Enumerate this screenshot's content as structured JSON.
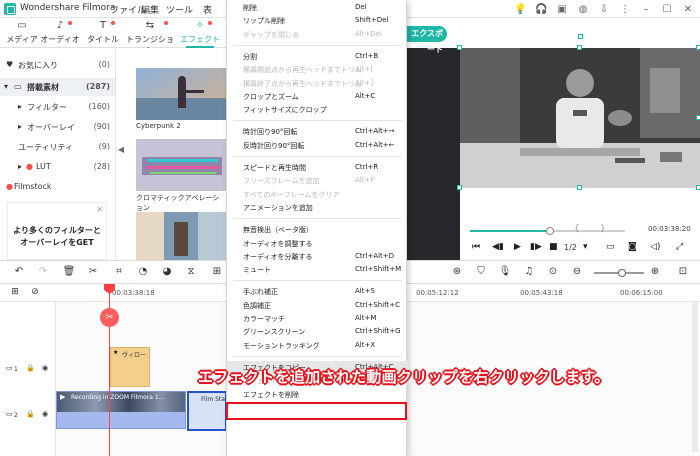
{
  "app": {
    "title": "Wondershare Filmora"
  },
  "menubar": {
    "items": [
      "ファイル",
      "編集",
      "ツール",
      "表"
    ]
  },
  "media_tabs": [
    {
      "label": "メディア",
      "icon": "folder-icon",
      "badge": false
    },
    {
      "label": "オーディオ",
      "icon": "music-note-icon",
      "badge": true
    },
    {
      "label": "タイトル",
      "icon": "text-icon",
      "badge": true
    },
    {
      "label": "トランジション",
      "icon": "transition-icon",
      "badge": true
    },
    {
      "label": "エフェクト",
      "icon": "effect-icon",
      "badge": true,
      "active": true
    }
  ],
  "categories": [
    {
      "label": "お気に入り",
      "count": "(0)",
      "icon": "heart-icon"
    },
    {
      "label": "搭載素材",
      "count": "(287)",
      "icon": "folder-icon",
      "selected": true
    },
    {
      "label": "フィルター",
      "count": "(160)"
    },
    {
      "label": "オーバーレイ",
      "count": "(90)"
    },
    {
      "label": "ユーティリティ",
      "count": "(9)"
    },
    {
      "label": "LUT",
      "count": "(28)"
    },
    {
      "label": "Filmstock",
      "count": ""
    }
  ],
  "promo": {
    "line1": "より多くのフィルターと",
    "line2": "オーバーレイをGET"
  },
  "thumbnails": [
    {
      "label": "Cyberpunk 2"
    },
    {
      "label": "クロマティックアベレーション"
    },
    {
      "label": ""
    }
  ],
  "export": {
    "label": "エクスポート"
  },
  "player": {
    "timecode": "00:03:38:20",
    "speed": "1/2"
  },
  "timeline": {
    "ruler": [
      "00:03:38:18",
      "00:05:12:12",
      "00:05:43:18",
      "00:06:15:00"
    ],
    "tracks": [
      {
        "index": "1",
        "clip_label": "ヴィロー"
      },
      {
        "index": "2",
        "clip_label": "Recording in ZOOM Filmora 1..."
      }
    ],
    "clip2_label": "Film Start"
  },
  "context_menu": {
    "items": [
      {
        "label": "削除",
        "shortcut": "Del"
      },
      {
        "label": "リップル削除",
        "shortcut": "Shift+Del"
      },
      {
        "label": "ギャップを閉じる",
        "shortcut": "Alt+Del",
        "disabled": true
      },
      {
        "sep": true
      },
      {
        "label": "分割",
        "shortcut": "Ctrl+B"
      },
      {
        "label": "横幕開始点から再生ヘッドまでトリム",
        "shortcut": "Alt+[",
        "disabled": true
      },
      {
        "label": "横幕終了点から再生ヘッドまでトリム",
        "shortcut": "Alt+]",
        "disabled": true
      },
      {
        "label": "クロップとズーム",
        "shortcut": "Alt+C"
      },
      {
        "label": "フィットサイズにクロップ",
        "shortcut": ""
      },
      {
        "sep": true
      },
      {
        "label": "時計回り90°回転",
        "shortcut": "Ctrl+Alt+→"
      },
      {
        "label": "反時計回り90°回転",
        "shortcut": "Ctrl+Alt+←"
      },
      {
        "sep": true
      },
      {
        "label": "スピードと再生時間",
        "shortcut": "Ctrl+R"
      },
      {
        "label": "フリーズフレームを追加",
        "shortcut": "Alt+F",
        "disabled": true
      },
      {
        "label": "すべてのキーフレームをクリア",
        "shortcut": "",
        "disabled": true
      },
      {
        "label": "アニメーションを追加",
        "shortcut": ""
      },
      {
        "sep": true
      },
      {
        "label": "無音検出（ベータ版）",
        "shortcut": ""
      },
      {
        "label": "オーディオを調整する",
        "shortcut": ""
      },
      {
        "label": "オーディオを分離する",
        "shortcut": "Ctrl+Alt+D"
      },
      {
        "label": "ミュート",
        "shortcut": "Ctrl+Shift+M"
      },
      {
        "sep": true
      },
      {
        "label": "手ぶれ補正",
        "shortcut": "Alt+S"
      },
      {
        "label": "色調補正",
        "shortcut": "Ctrl+Shift+C"
      },
      {
        "label": "カラーマッチ",
        "shortcut": "Alt+M"
      },
      {
        "label": "グリーンスクリーン",
        "shortcut": "Ctrl+Shift+G"
      },
      {
        "label": "モーショントラッキング",
        "shortcut": "Alt+X"
      },
      {
        "sep": true
      },
      {
        "label": "エフェクトをコピー",
        "shortcut": "Ctrl+Alt+C",
        "highlighted": true
      },
      {
        "label": "エフェクトをペースト",
        "shortcut": "Ctrl+Alt+V",
        "disabled": true
      },
      {
        "label": "エフェクトを削除",
        "shortcut": ""
      }
    ]
  },
  "annotation": "エフェクトを追加された動画クリップを右クリックします。",
  "colors": {
    "accent": "#1fb7a6",
    "highlight_border": "#e8101a",
    "playhead": "#ff4141"
  }
}
